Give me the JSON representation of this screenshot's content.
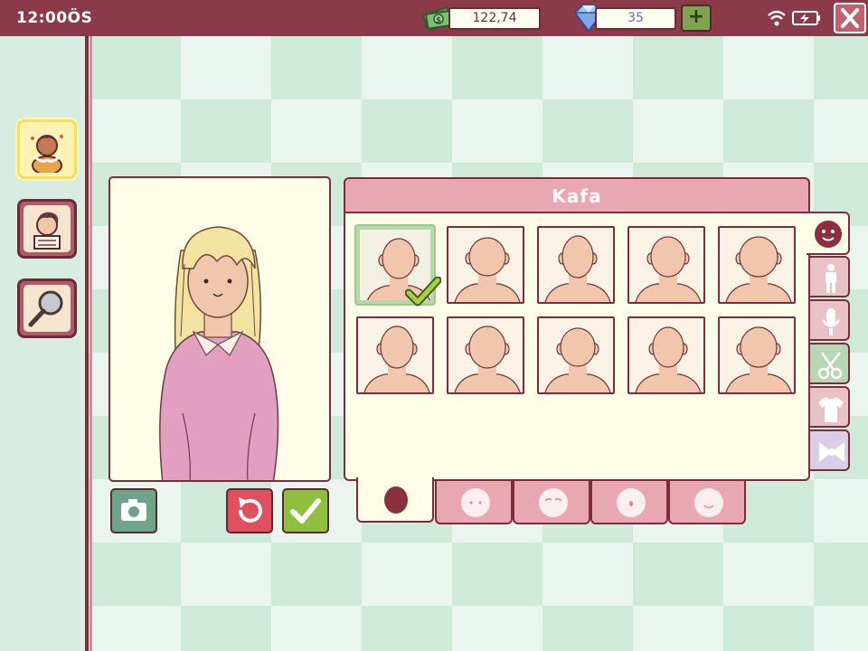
{
  "status_bar": {
    "clock": "12:00ÖS",
    "money": "122,74",
    "gems": "35",
    "plus_label": "+"
  },
  "sidebar": {
    "items": [
      {
        "name": "character-creator",
        "active": true
      },
      {
        "name": "profile-card",
        "active": false
      },
      {
        "name": "search",
        "active": false
      }
    ]
  },
  "panel": {
    "title": "Kafa",
    "selected_index": 0,
    "head_options": 10,
    "categories": [
      "face",
      "body",
      "voice",
      "hair-scissors",
      "clothing",
      "accessory-bow"
    ],
    "active_category": "face",
    "sub_tabs": [
      "head-shape",
      "eyes",
      "eyebrows",
      "nose",
      "mouth"
    ],
    "active_sub_tab": "head-shape"
  },
  "colors": {
    "top_bar": "#8b3a4a",
    "panel_header": "#e9a7b4",
    "accent_green": "#8fbf3f",
    "accent_red": "#e0505f",
    "skin": "#f2c6ad",
    "hair": "#f3e3a0",
    "sweater": "#e2a0c0"
  }
}
